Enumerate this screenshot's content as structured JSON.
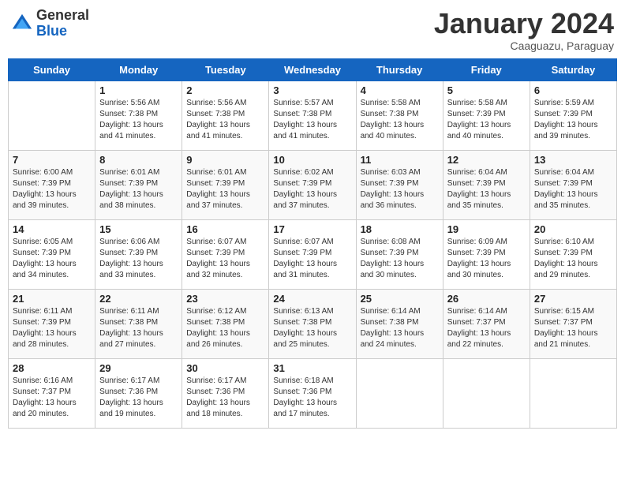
{
  "logo": {
    "general": "General",
    "blue": "Blue"
  },
  "title": "January 2024",
  "location": "Caaguazu, Paraguay",
  "days_of_week": [
    "Sunday",
    "Monday",
    "Tuesday",
    "Wednesday",
    "Thursday",
    "Friday",
    "Saturday"
  ],
  "weeks": [
    [
      {
        "day": "",
        "info": ""
      },
      {
        "day": "1",
        "info": "Sunrise: 5:56 AM\nSunset: 7:38 PM\nDaylight: 13 hours and 41 minutes."
      },
      {
        "day": "2",
        "info": "Sunrise: 5:56 AM\nSunset: 7:38 PM\nDaylight: 13 hours and 41 minutes."
      },
      {
        "day": "3",
        "info": "Sunrise: 5:57 AM\nSunset: 7:38 PM\nDaylight: 13 hours and 41 minutes."
      },
      {
        "day": "4",
        "info": "Sunrise: 5:58 AM\nSunset: 7:38 PM\nDaylight: 13 hours and 40 minutes."
      },
      {
        "day": "5",
        "info": "Sunrise: 5:58 AM\nSunset: 7:39 PM\nDaylight: 13 hours and 40 minutes."
      },
      {
        "day": "6",
        "info": "Sunrise: 5:59 AM\nSunset: 7:39 PM\nDaylight: 13 hours and 39 minutes."
      }
    ],
    [
      {
        "day": "7",
        "info": "Sunrise: 6:00 AM\nSunset: 7:39 PM\nDaylight: 13 hours and 39 minutes."
      },
      {
        "day": "8",
        "info": "Sunrise: 6:01 AM\nSunset: 7:39 PM\nDaylight: 13 hours and 38 minutes."
      },
      {
        "day": "9",
        "info": "Sunrise: 6:01 AM\nSunset: 7:39 PM\nDaylight: 13 hours and 37 minutes."
      },
      {
        "day": "10",
        "info": "Sunrise: 6:02 AM\nSunset: 7:39 PM\nDaylight: 13 hours and 37 minutes."
      },
      {
        "day": "11",
        "info": "Sunrise: 6:03 AM\nSunset: 7:39 PM\nDaylight: 13 hours and 36 minutes."
      },
      {
        "day": "12",
        "info": "Sunrise: 6:04 AM\nSunset: 7:39 PM\nDaylight: 13 hours and 35 minutes."
      },
      {
        "day": "13",
        "info": "Sunrise: 6:04 AM\nSunset: 7:39 PM\nDaylight: 13 hours and 35 minutes."
      }
    ],
    [
      {
        "day": "14",
        "info": "Sunrise: 6:05 AM\nSunset: 7:39 PM\nDaylight: 13 hours and 34 minutes."
      },
      {
        "day": "15",
        "info": "Sunrise: 6:06 AM\nSunset: 7:39 PM\nDaylight: 13 hours and 33 minutes."
      },
      {
        "day": "16",
        "info": "Sunrise: 6:07 AM\nSunset: 7:39 PM\nDaylight: 13 hours and 32 minutes."
      },
      {
        "day": "17",
        "info": "Sunrise: 6:07 AM\nSunset: 7:39 PM\nDaylight: 13 hours and 31 minutes."
      },
      {
        "day": "18",
        "info": "Sunrise: 6:08 AM\nSunset: 7:39 PM\nDaylight: 13 hours and 30 minutes."
      },
      {
        "day": "19",
        "info": "Sunrise: 6:09 AM\nSunset: 7:39 PM\nDaylight: 13 hours and 30 minutes."
      },
      {
        "day": "20",
        "info": "Sunrise: 6:10 AM\nSunset: 7:39 PM\nDaylight: 13 hours and 29 minutes."
      }
    ],
    [
      {
        "day": "21",
        "info": "Sunrise: 6:11 AM\nSunset: 7:39 PM\nDaylight: 13 hours and 28 minutes."
      },
      {
        "day": "22",
        "info": "Sunrise: 6:11 AM\nSunset: 7:38 PM\nDaylight: 13 hours and 27 minutes."
      },
      {
        "day": "23",
        "info": "Sunrise: 6:12 AM\nSunset: 7:38 PM\nDaylight: 13 hours and 26 minutes."
      },
      {
        "day": "24",
        "info": "Sunrise: 6:13 AM\nSunset: 7:38 PM\nDaylight: 13 hours and 25 minutes."
      },
      {
        "day": "25",
        "info": "Sunrise: 6:14 AM\nSunset: 7:38 PM\nDaylight: 13 hours and 24 minutes."
      },
      {
        "day": "26",
        "info": "Sunrise: 6:14 AM\nSunset: 7:37 PM\nDaylight: 13 hours and 22 minutes."
      },
      {
        "day": "27",
        "info": "Sunrise: 6:15 AM\nSunset: 7:37 PM\nDaylight: 13 hours and 21 minutes."
      }
    ],
    [
      {
        "day": "28",
        "info": "Sunrise: 6:16 AM\nSunset: 7:37 PM\nDaylight: 13 hours and 20 minutes."
      },
      {
        "day": "29",
        "info": "Sunrise: 6:17 AM\nSunset: 7:36 PM\nDaylight: 13 hours and 19 minutes."
      },
      {
        "day": "30",
        "info": "Sunrise: 6:17 AM\nSunset: 7:36 PM\nDaylight: 13 hours and 18 minutes."
      },
      {
        "day": "31",
        "info": "Sunrise: 6:18 AM\nSunset: 7:36 PM\nDaylight: 13 hours and 17 minutes."
      },
      {
        "day": "",
        "info": ""
      },
      {
        "day": "",
        "info": ""
      },
      {
        "day": "",
        "info": ""
      }
    ]
  ]
}
